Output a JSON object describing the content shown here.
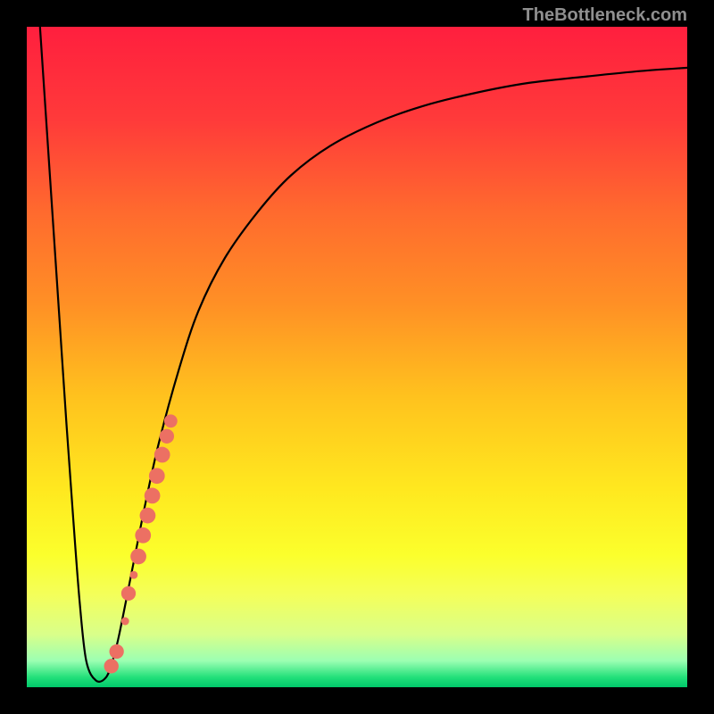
{
  "watermark": "TheBottleneck.com",
  "chart_data": {
    "type": "line",
    "title": "",
    "xlabel": "",
    "ylabel": "",
    "xlim": [
      0,
      100
    ],
    "ylim": [
      0,
      100
    ],
    "gradient_stops": [
      {
        "offset": 0,
        "color": "#ff1f3e"
      },
      {
        "offset": 0.14,
        "color": "#ff3a3a"
      },
      {
        "offset": 0.28,
        "color": "#ff6a2e"
      },
      {
        "offset": 0.42,
        "color": "#ff9025"
      },
      {
        "offset": 0.56,
        "color": "#ffc21e"
      },
      {
        "offset": 0.7,
        "color": "#ffe81f"
      },
      {
        "offset": 0.8,
        "color": "#fbff2c"
      },
      {
        "offset": 0.86,
        "color": "#f4ff5a"
      },
      {
        "offset": 0.92,
        "color": "#d9ff8a"
      },
      {
        "offset": 0.96,
        "color": "#9cffb2"
      },
      {
        "offset": 0.985,
        "color": "#22e07a"
      },
      {
        "offset": 1.0,
        "color": "#00c86a"
      }
    ],
    "series": [
      {
        "name": "bottleneck-curve",
        "stroke": "#000000",
        "points": [
          {
            "x": 2.0,
            "y": 100.0
          },
          {
            "x": 3.0,
            "y": 85.0
          },
          {
            "x": 4.0,
            "y": 70.0
          },
          {
            "x": 5.0,
            "y": 55.0
          },
          {
            "x": 6.0,
            "y": 40.0
          },
          {
            "x": 7.0,
            "y": 26.0
          },
          {
            "x": 8.0,
            "y": 13.0
          },
          {
            "x": 9.0,
            "y": 4.0
          },
          {
            "x": 10.5,
            "y": 1.0
          },
          {
            "x": 12.0,
            "y": 1.5
          },
          {
            "x": 13.0,
            "y": 4.0
          },
          {
            "x": 14.0,
            "y": 8.0
          },
          {
            "x": 16.0,
            "y": 18.0
          },
          {
            "x": 18.0,
            "y": 28.0
          },
          {
            "x": 20.0,
            "y": 37.0
          },
          {
            "x": 23.0,
            "y": 48.0
          },
          {
            "x": 26.0,
            "y": 57.0
          },
          {
            "x": 30.0,
            "y": 65.0
          },
          {
            "x": 35.0,
            "y": 72.0
          },
          {
            "x": 40.0,
            "y": 77.5
          },
          {
            "x": 46.0,
            "y": 82.0
          },
          {
            "x": 53.0,
            "y": 85.5
          },
          {
            "x": 60.0,
            "y": 88.0
          },
          {
            "x": 68.0,
            "y": 90.0
          },
          {
            "x": 76.0,
            "y": 91.5
          },
          {
            "x": 85.0,
            "y": 92.5
          },
          {
            "x": 93.0,
            "y": 93.3
          },
          {
            "x": 100.0,
            "y": 93.8
          }
        ]
      }
    ],
    "markers": {
      "name": "highlight-segment",
      "color": "#ec7063",
      "points": [
        {
          "x": 12.8,
          "y": 3.2,
          "r": 1.1
        },
        {
          "x": 13.6,
          "y": 5.4,
          "r": 1.1
        },
        {
          "x": 14.9,
          "y": 10.0,
          "r": 0.6
        },
        {
          "x": 15.4,
          "y": 14.2,
          "r": 1.1
        },
        {
          "x": 16.2,
          "y": 17.0,
          "r": 0.6
        },
        {
          "x": 16.9,
          "y": 19.8,
          "r": 1.2
        },
        {
          "x": 17.6,
          "y": 23.0,
          "r": 1.2
        },
        {
          "x": 18.3,
          "y": 26.0,
          "r": 1.2
        },
        {
          "x": 19.0,
          "y": 29.0,
          "r": 1.2
        },
        {
          "x": 19.7,
          "y": 32.0,
          "r": 1.2
        },
        {
          "x": 20.5,
          "y": 35.2,
          "r": 1.2
        },
        {
          "x": 21.2,
          "y": 38.0,
          "r": 1.1
        },
        {
          "x": 21.8,
          "y": 40.3,
          "r": 1.0
        }
      ]
    }
  }
}
